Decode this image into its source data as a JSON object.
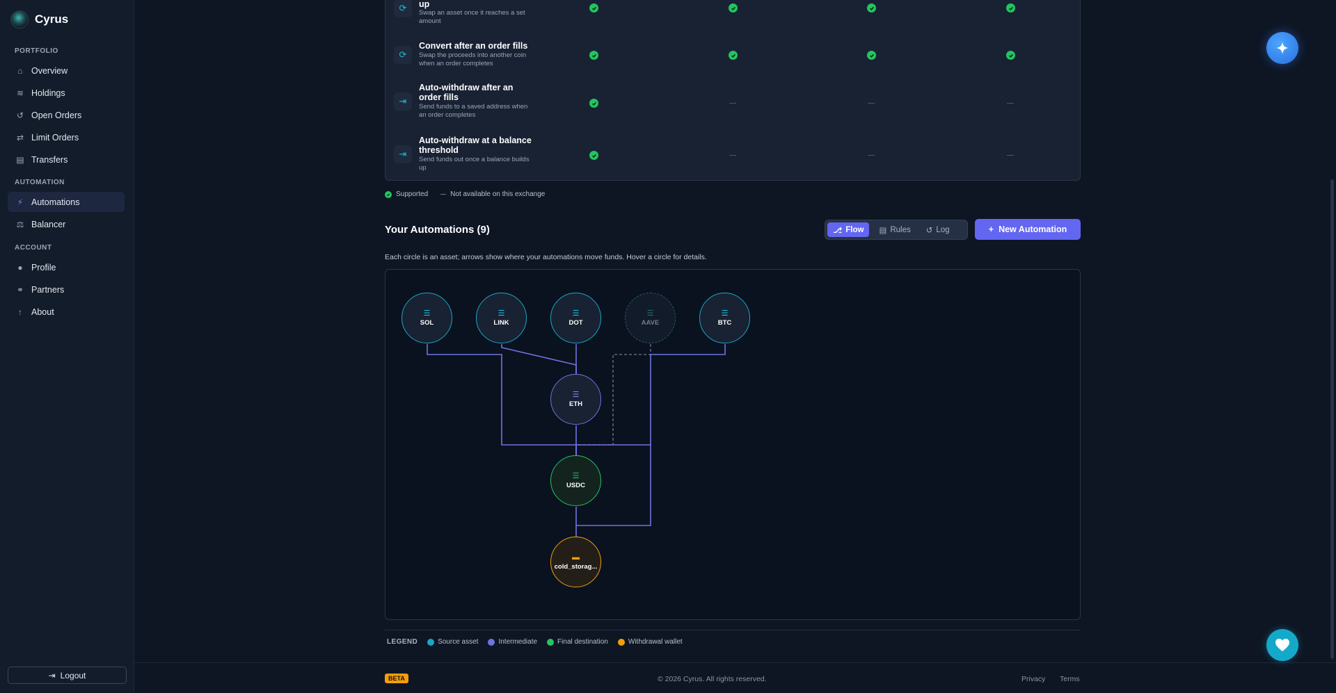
{
  "brand": {
    "name": "Cyrus"
  },
  "sidebar": {
    "sections": {
      "portfolio": "PORTFOLIO",
      "automation": "AUTOMATION",
      "account": "ACCOUNT"
    },
    "items": [
      {
        "label": "Overview",
        "icon": "home-icon"
      },
      {
        "label": "Holdings",
        "icon": "coins-icon"
      },
      {
        "label": "Open Orders",
        "icon": "history-icon"
      },
      {
        "label": "Limit Orders",
        "icon": "swap-arrows-icon"
      },
      {
        "label": "Transfers",
        "icon": "money-transfer-icon"
      },
      {
        "label": "Automations",
        "icon": "bolt-icon",
        "active": true
      },
      {
        "label": "Balancer",
        "icon": "scale-icon"
      },
      {
        "label": "Profile",
        "icon": "user-icon"
      },
      {
        "label": "Partners",
        "icon": "handshake-icon"
      },
      {
        "label": "About",
        "icon": "info-icon"
      }
    ],
    "logout_label": "Logout"
  },
  "features": [
    {
      "title": "up",
      "desc": "Swap an asset once it reaches a set amount",
      "support": [
        true,
        true,
        true,
        true
      ]
    },
    {
      "title": "Convert after an order fills",
      "desc": "Swap the proceeds into another coin when an order completes",
      "support": [
        true,
        true,
        true,
        true
      ]
    },
    {
      "title": "Auto-withdraw after an order fills",
      "desc": "Send funds to a saved address when an order completes",
      "support": [
        true,
        false,
        false,
        false
      ]
    },
    {
      "title": "Auto-withdraw at a balance threshold",
      "desc": "Send funds out once a balance builds up",
      "support": [
        true,
        false,
        false,
        false
      ]
    }
  ],
  "feature_legend": {
    "supported": "Supported",
    "not_available": "Not available on this exchange"
  },
  "automations": {
    "title": "Your Automations (9)",
    "views": [
      "Flow",
      "Rules",
      "Log"
    ],
    "active_view": "Flow",
    "new_button": "New Automation",
    "hint": "Each circle is an asset; arrows show where your automations move funds. Hover a circle for details."
  },
  "flow": {
    "nodes": [
      {
        "id": "SOL",
        "label": "SOL",
        "kind": "source"
      },
      {
        "id": "LINK",
        "label": "LINK",
        "kind": "source"
      },
      {
        "id": "DOT",
        "label": "DOT",
        "kind": "source"
      },
      {
        "id": "AAVE",
        "label": "AAVE",
        "kind": "source",
        "inactive": true
      },
      {
        "id": "BTC",
        "label": "BTC",
        "kind": "source"
      },
      {
        "id": "ETH",
        "label": "ETH",
        "kind": "intermediate"
      },
      {
        "id": "USDC",
        "label": "USDC",
        "kind": "final"
      },
      {
        "id": "cold_storage",
        "label": "cold_storag...",
        "kind": "wallet"
      }
    ],
    "edges": [
      {
        "from": "SOL",
        "to": "USDC"
      },
      {
        "from": "LINK",
        "to": "ETH"
      },
      {
        "from": "DOT",
        "to": "ETH"
      },
      {
        "from": "ETH",
        "to": "USDC"
      },
      {
        "from": "AAVE",
        "to": "USDC",
        "inactive": true
      },
      {
        "from": "BTC",
        "to": "USDC"
      },
      {
        "from": "BTC",
        "to": "cold_storage"
      },
      {
        "from": "USDC",
        "to": "cold_storage"
      }
    ]
  },
  "flow_legend": {
    "title": "LEGEND",
    "items": [
      {
        "label": "Source asset",
        "color": "#1aa7c4"
      },
      {
        "label": "Intermediate",
        "color": "#7073e0"
      },
      {
        "label": "Final destination",
        "color": "#22c55e"
      },
      {
        "label": "Withdrawal wallet",
        "color": "#f59e0b"
      }
    ]
  },
  "footer": {
    "badge": "BETA",
    "copyright": "© 2026 Cyrus. All rights reserved.",
    "links": [
      "Privacy",
      "Terms"
    ]
  },
  "colors": {
    "accent": "#6366f1",
    "success": "#22c55e",
    "source": "#1aa7c4",
    "wallet": "#f59e0b"
  }
}
